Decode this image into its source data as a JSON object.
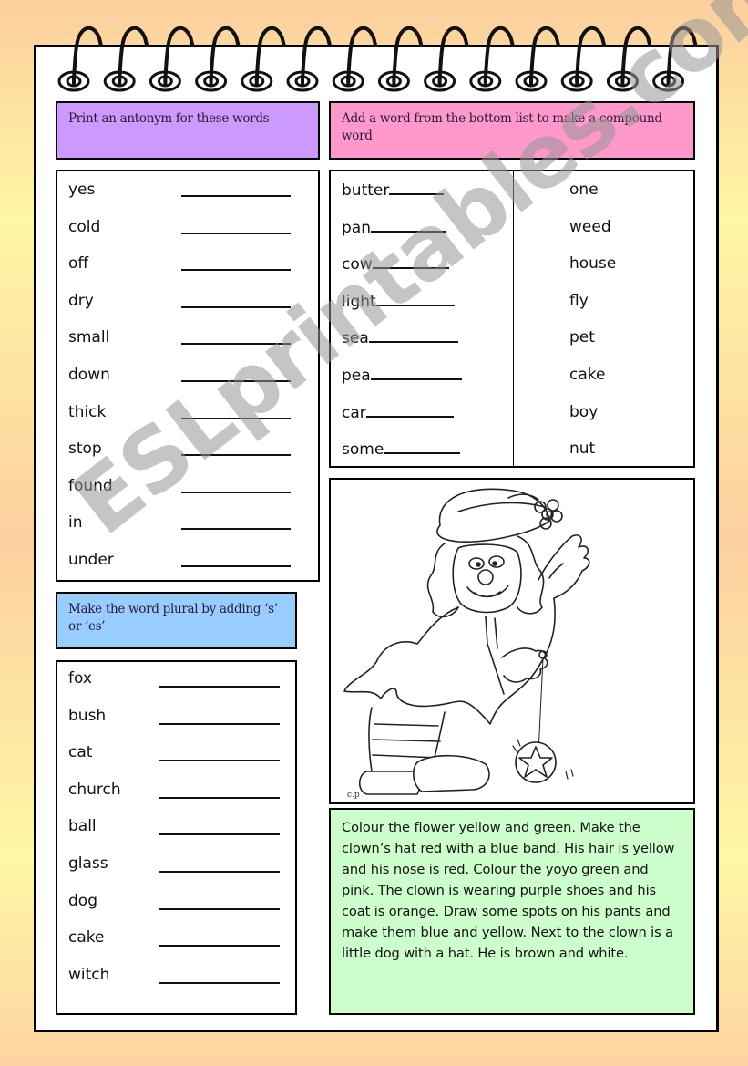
{
  "antonyms": {
    "instruction": "Print an antonym for these words",
    "words": [
      "yes",
      "cold",
      "off",
      "dry",
      "small",
      "down",
      "thick",
      "stop",
      "found",
      "in",
      "under"
    ]
  },
  "compound": {
    "instruction": "Add a word from the bottom list to make a compound word",
    "stems": [
      "butter",
      "pan",
      "cow",
      "light",
      "sea",
      "pea",
      "car",
      "some"
    ],
    "options": [
      "one",
      "weed",
      "house",
      "fly",
      "pet",
      "cake",
      "boy",
      "nut"
    ]
  },
  "plurals": {
    "instruction": "Make the word plural by adding ‘s’ or ‘es’",
    "words": [
      "fox",
      "bush",
      "cat",
      "church",
      "ball",
      "glass",
      "dog",
      "cake",
      "witch"
    ]
  },
  "picture": {
    "description": "Clown playing with a yoyo (coloring picture)",
    "signature": "c.p"
  },
  "coloring": {
    "instructions": "Colour the flower yellow and green. Make the clown’s hat red with a blue band. His hair is yellow and his nose is red. Colour the yoyo green and pink. The clown is wearing purple shoes and his coat is orange. Draw some spots on his pants and make them blue and yellow. Next to the clown is a little dog with a hat. He is brown and white."
  },
  "watermark": "ESLprintables.com",
  "colors": {
    "antonym_header": "#cc99ff",
    "compound_header": "#ff99cc",
    "plural_header": "#99ccff",
    "coloring_box": "#ccffcc"
  }
}
